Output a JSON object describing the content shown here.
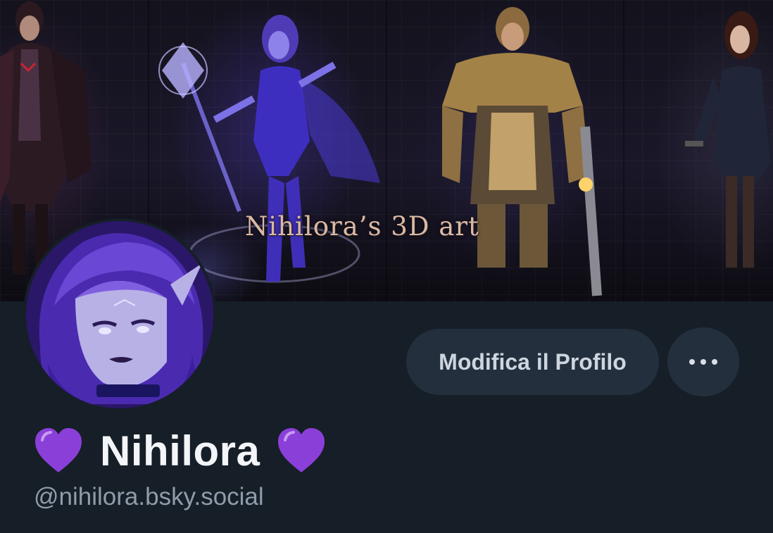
{
  "banner": {
    "title_text": "Nihilora’s 3D art"
  },
  "profile": {
    "display_name": "Nihilora",
    "name_prefix_emoji": "purple-heart",
    "name_suffix_emoji": "purple-heart",
    "handle": "@nihilora.bsky.social"
  },
  "actions": {
    "edit_profile_label": "Modifica il Profilo",
    "more_icon": "ellipsis-icon"
  },
  "colors": {
    "background": "#161e27",
    "button_bg": "#242f3e",
    "name_text": "#f3f5f8",
    "handle_text": "#8f9cab",
    "heart": "#8b3fd9"
  }
}
